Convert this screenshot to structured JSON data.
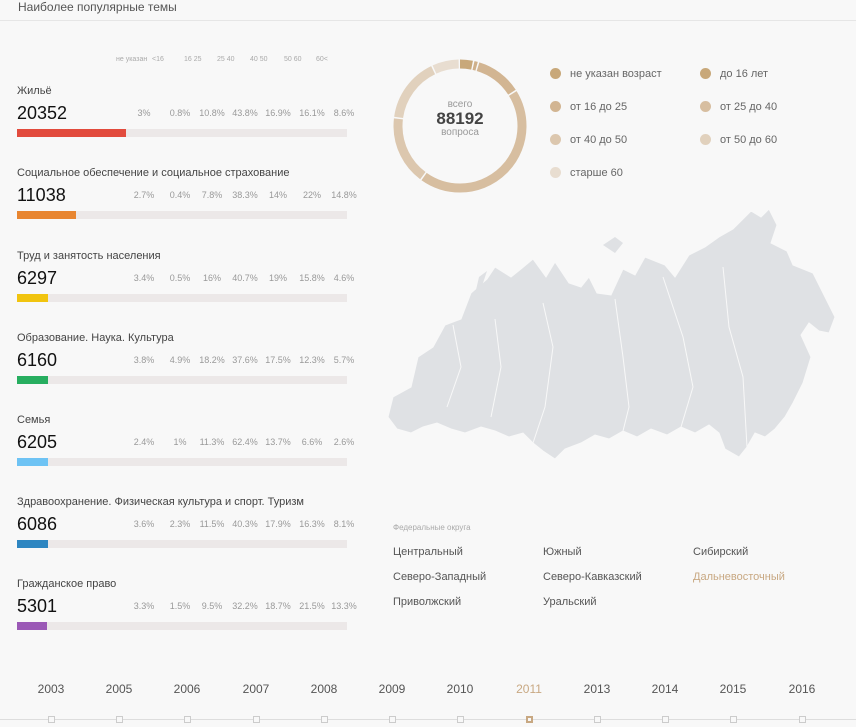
{
  "page": {
    "title": "Наиболее популярные темы"
  },
  "age_headers": [
    "не указан",
    "<16",
    "16 25",
    "25 40",
    "40 50",
    "50 60",
    "60<"
  ],
  "topics": [
    {
      "name": "Жильё",
      "count": "20352",
      "share": 0.33,
      "color": "#e24b3d",
      "pcts": [
        "3%",
        "0.8%",
        "10.8%",
        "43.8%",
        "16.9%",
        "16.1%",
        "8.6%"
      ]
    },
    {
      "name": "Социальное обеспечение и социальное страхование",
      "count": "11038",
      "share": 0.18,
      "color": "#e88530",
      "pcts": [
        "2.7%",
        "0.4%",
        "7.8%",
        "38.3%",
        "14%",
        "22%",
        "14.8%"
      ]
    },
    {
      "name": "Труд и занятость населения",
      "count": "6297",
      "share": 0.095,
      "color": "#f1c40f",
      "pcts": [
        "3.4%",
        "0.5%",
        "16%",
        "40.7%",
        "19%",
        "15.8%",
        "4.6%"
      ]
    },
    {
      "name": "Образование. Наука. Культура",
      "count": "6160",
      "share": 0.095,
      "color": "#27ae60",
      "pcts": [
        "3.8%",
        "4.9%",
        "18.2%",
        "37.6%",
        "17.5%",
        "12.3%",
        "5.7%"
      ]
    },
    {
      "name": "Семья",
      "count": "6205",
      "share": 0.095,
      "color": "#6ec3f4",
      "pcts": [
        "2.4%",
        "1%",
        "11.3%",
        "62.4%",
        "13.7%",
        "6.6%",
        "2.6%"
      ]
    },
    {
      "name": "Здравоохранение. Физическая культура и спорт. Туризм",
      "count": "6086",
      "share": 0.095,
      "color": "#2e86c1",
      "pcts": [
        "3.6%",
        "2.3%",
        "11.5%",
        "40.3%",
        "17.9%",
        "16.3%",
        "8.1%"
      ]
    },
    {
      "name": "Гражданское право",
      "count": "5301",
      "share": 0.09,
      "color": "#9b59b6",
      "pcts": [
        "3.3%",
        "1.5%",
        "9.5%",
        "32.2%",
        "18.7%",
        "21.5%",
        "13.3%"
      ]
    }
  ],
  "summary": {
    "top": "всего",
    "value": "88192",
    "bottom": "вопроса"
  },
  "donut_segments": [
    {
      "share": 0.035,
      "color": "#c8a87a"
    },
    {
      "share": 0.012,
      "color": "#cfb08a"
    },
    {
      "share": 0.115,
      "color": "#d2b592"
    },
    {
      "share": 0.44,
      "color": "#d7bea0"
    },
    {
      "share": 0.17,
      "color": "#dcc7ae"
    },
    {
      "share": 0.16,
      "color": "#e1d1bd"
    },
    {
      "share": 0.068,
      "color": "#e8ddd0"
    }
  ],
  "legend": [
    {
      "label": "не указан возраст",
      "color": "#c8a87a"
    },
    {
      "label": "до 16 лет",
      "color": "#c8a87a"
    },
    {
      "label": "от 16 до 25",
      "color": "#d2b592"
    },
    {
      "label": "от 25 до 40",
      "color": "#d7bea0"
    },
    {
      "label": "от 40 до 50",
      "color": "#dcc7ae"
    },
    {
      "label": "от 50 до 60",
      "color": "#e1d1bd"
    },
    {
      "label": "старше 60",
      "color": "#e8ddd0"
    }
  ],
  "districts": {
    "title": "Федеральные округа",
    "items": [
      {
        "label": "Центральный",
        "active": false
      },
      {
        "label": "Северо-Западный",
        "active": false
      },
      {
        "label": "Приволжский",
        "active": false
      },
      {
        "label": "Южный",
        "active": false
      },
      {
        "label": "Северо-Кавказский",
        "active": false
      },
      {
        "label": "Уральский",
        "active": false
      },
      {
        "label": "Сибирский",
        "active": false
      },
      {
        "label": "Дальневосточный",
        "active": true
      }
    ]
  },
  "timeline": {
    "years": [
      "2003",
      "2005",
      "2006",
      "2007",
      "2008",
      "2009",
      "2010",
      "2011",
      "2013",
      "2014",
      "2015",
      "2016"
    ],
    "selected": "2011"
  },
  "colors": {
    "accent": "#c8a882",
    "map_fill": "#dfe1e4"
  }
}
